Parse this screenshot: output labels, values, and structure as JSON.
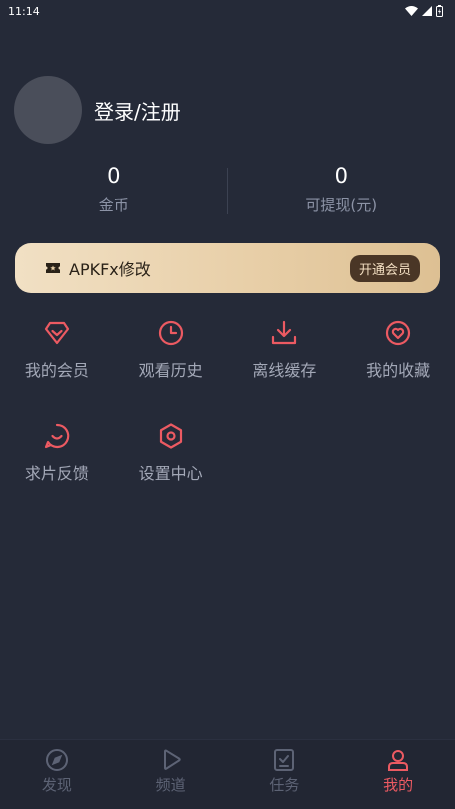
{
  "status_bar": {
    "time": "11:14"
  },
  "profile": {
    "login_label": "登录/注册"
  },
  "stats": [
    {
      "value": "0",
      "label": "金币"
    },
    {
      "value": "0",
      "label": "可提现(元)"
    }
  ],
  "vip": {
    "text": "APKFx修改",
    "button_label": "开通会员"
  },
  "features": [
    {
      "label": "我的会员",
      "icon": "diamond-icon"
    },
    {
      "label": "观看历史",
      "icon": "clock-icon"
    },
    {
      "label": "离线缓存",
      "icon": "download-icon"
    },
    {
      "label": "我的收藏",
      "icon": "heart-icon"
    },
    {
      "label": "求片反馈",
      "icon": "chat-bubble-icon"
    },
    {
      "label": "设置中心",
      "icon": "settings-hexagon-icon"
    }
  ],
  "tabs": [
    {
      "label": "发现",
      "icon": "compass-icon",
      "active": false
    },
    {
      "label": "频道",
      "icon": "play-icon",
      "active": false
    },
    {
      "label": "任务",
      "icon": "checklist-icon",
      "active": false
    },
    {
      "label": "我的",
      "icon": "user-icon",
      "active": true
    }
  ],
  "colors": {
    "background": "#252a38",
    "accent": "#ec5a62",
    "muted_text": "#8c93a6",
    "vip_gold": "#e8cfa8"
  }
}
